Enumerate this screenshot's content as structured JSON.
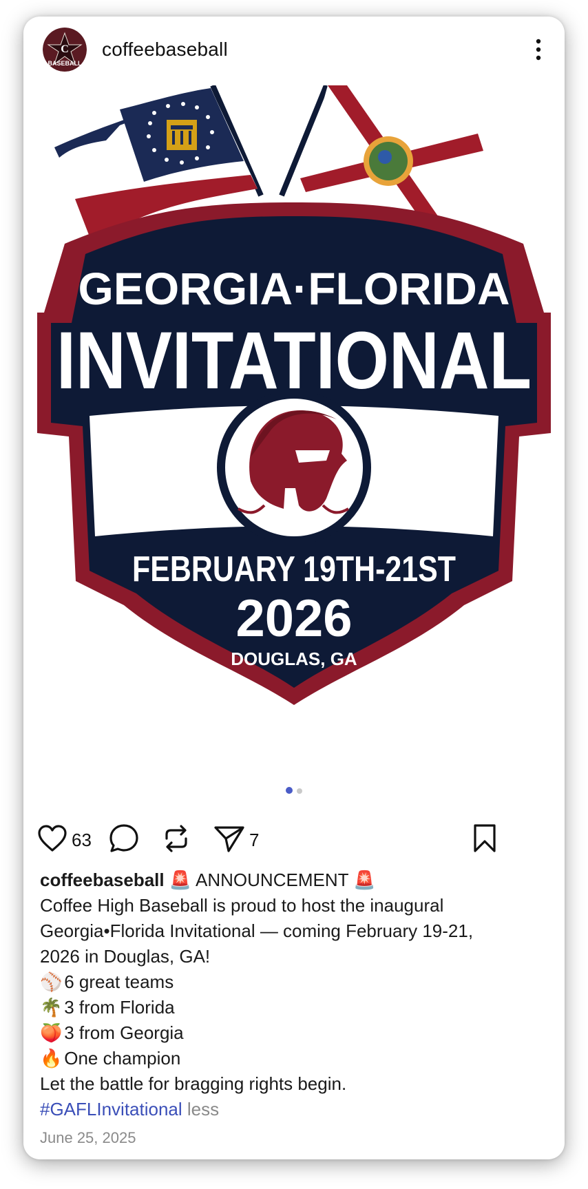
{
  "post": {
    "username": "coffeebaseball",
    "avatar_text": "BASEBALL",
    "avatar_letter": "C",
    "menu_icon": "more-vertical-icon"
  },
  "image": {
    "line1": "GEORGIA·FLORIDA",
    "line2": "INVITATIONAL",
    "dates": "FEBRUARY 19TH-21ST",
    "year": "2026",
    "location": "DOUGLAS, GA",
    "colors": {
      "navy": "#0e1a36",
      "maroon": "#8b1a2b",
      "white": "#ffffff",
      "gold": "#d4a017"
    }
  },
  "carousel": {
    "current": 1,
    "total": 2,
    "active_color": "#4a5cc7",
    "inactive_color": "#c9c9c9"
  },
  "actions": {
    "like_count": "63",
    "share_count": "7",
    "icons": [
      "heart-icon",
      "comment-icon",
      "repost-icon",
      "send-icon",
      "bookmark-icon"
    ]
  },
  "caption": {
    "username": "coffeebaseball",
    "headline": "🚨 ANNOUNCEMENT 🚨",
    "line1": "Coffee High Baseball is proud to host the inaugural",
    "line2": "Georgia•Florida Invitational — coming February 19-21,",
    "line3": "2026 in Douglas, GA!",
    "b1_emoji": "⚾",
    "b1_text": "6 great teams",
    "b2_emoji": "🌴",
    "b2_text": "3 from Florida",
    "b3_emoji": "🍑",
    "b3_text": "3 from Georgia",
    "b4_emoji": "🔥",
    "b4_text": "One champion",
    "closing": "Let the battle for bragging rights begin.",
    "hashtag": "#GAFLInvitational",
    "less": "less"
  },
  "date": "June 25, 2025"
}
